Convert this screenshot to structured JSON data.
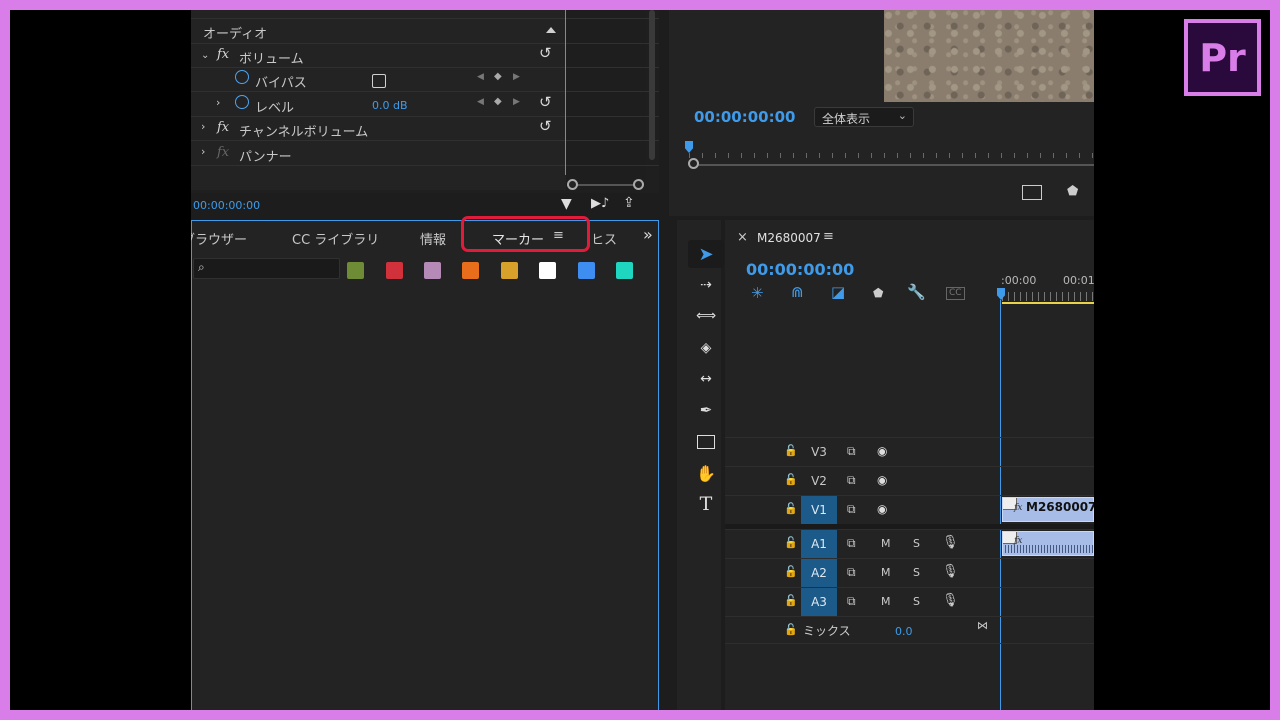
{
  "brand": {
    "logo_text": "Pr",
    "accent": "#d97ee8"
  },
  "effect_controls": {
    "section_audio": "オーディオ",
    "volume": "ボリューム",
    "bypass": "バイパス",
    "level": "レベル",
    "level_value": "0.0 dB",
    "channel_volume": "チャンネルボリューム",
    "panner": "パンナー",
    "fx": "fx",
    "timecode": "00:00:00:00"
  },
  "program_monitor": {
    "timecode": "00:00:00:00",
    "zoom_select": "全体表示"
  },
  "marker_panel": {
    "tabs": [
      "ブラウザー",
      "CC ライブラリ",
      "情報",
      "マーカー",
      "ヒス"
    ],
    "active_tab": "マーカー",
    "overflow": "»",
    "swatch_colors": [
      "#6e8b35",
      "#d0313b",
      "#b68ab6",
      "#e86e1c",
      "#d8a22a",
      "#ffffff",
      "#3d8ef0",
      "#1fd6c0"
    ]
  },
  "timeline": {
    "sequence_name": "M2680007",
    "close": "×",
    "timecode": "00:00:00:00",
    "ruler_labels": [
      ":00:00",
      "00:01:"
    ],
    "tracks_video": [
      {
        "name": "V3",
        "targeted": false
      },
      {
        "name": "V2",
        "targeted": false
      },
      {
        "name": "V1",
        "targeted": true
      }
    ],
    "tracks_audio": [
      {
        "name": "A1",
        "targeted": true
      },
      {
        "name": "A2",
        "targeted": true
      },
      {
        "name": "A3",
        "targeted": true
      }
    ],
    "mute": "M",
    "solo": "S",
    "mix_label": "ミックス",
    "mix_value": "0.0",
    "clip_name": "M2680007.",
    "cc_label": "CC"
  }
}
